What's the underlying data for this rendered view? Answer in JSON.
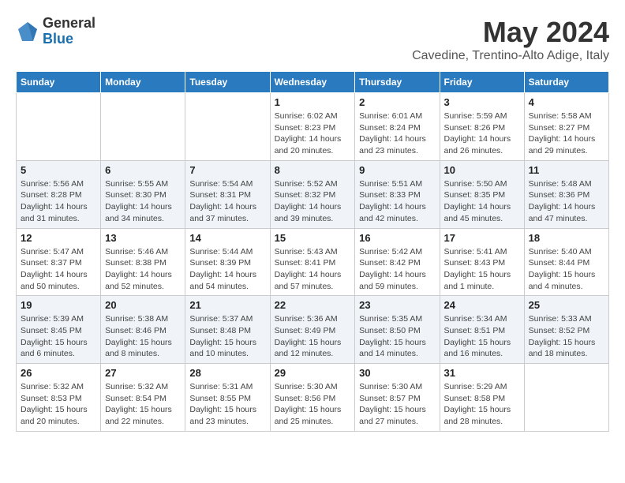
{
  "header": {
    "logo_general": "General",
    "logo_blue": "Blue",
    "month": "May 2024",
    "location": "Cavedine, Trentino-Alto Adige, Italy"
  },
  "days_of_week": [
    "Sunday",
    "Monday",
    "Tuesday",
    "Wednesday",
    "Thursday",
    "Friday",
    "Saturday"
  ],
  "weeks": [
    [
      {
        "day": "",
        "sunrise": "",
        "sunset": "",
        "daylight": ""
      },
      {
        "day": "",
        "sunrise": "",
        "sunset": "",
        "daylight": ""
      },
      {
        "day": "",
        "sunrise": "",
        "sunset": "",
        "daylight": ""
      },
      {
        "day": "1",
        "sunrise": "Sunrise: 6:02 AM",
        "sunset": "Sunset: 8:23 PM",
        "daylight": "Daylight: 14 hours and 20 minutes."
      },
      {
        "day": "2",
        "sunrise": "Sunrise: 6:01 AM",
        "sunset": "Sunset: 8:24 PM",
        "daylight": "Daylight: 14 hours and 23 minutes."
      },
      {
        "day": "3",
        "sunrise": "Sunrise: 5:59 AM",
        "sunset": "Sunset: 8:26 PM",
        "daylight": "Daylight: 14 hours and 26 minutes."
      },
      {
        "day": "4",
        "sunrise": "Sunrise: 5:58 AM",
        "sunset": "Sunset: 8:27 PM",
        "daylight": "Daylight: 14 hours and 29 minutes."
      }
    ],
    [
      {
        "day": "5",
        "sunrise": "Sunrise: 5:56 AM",
        "sunset": "Sunset: 8:28 PM",
        "daylight": "Daylight: 14 hours and 31 minutes."
      },
      {
        "day": "6",
        "sunrise": "Sunrise: 5:55 AM",
        "sunset": "Sunset: 8:30 PM",
        "daylight": "Daylight: 14 hours and 34 minutes."
      },
      {
        "day": "7",
        "sunrise": "Sunrise: 5:54 AM",
        "sunset": "Sunset: 8:31 PM",
        "daylight": "Daylight: 14 hours and 37 minutes."
      },
      {
        "day": "8",
        "sunrise": "Sunrise: 5:52 AM",
        "sunset": "Sunset: 8:32 PM",
        "daylight": "Daylight: 14 hours and 39 minutes."
      },
      {
        "day": "9",
        "sunrise": "Sunrise: 5:51 AM",
        "sunset": "Sunset: 8:33 PM",
        "daylight": "Daylight: 14 hours and 42 minutes."
      },
      {
        "day": "10",
        "sunrise": "Sunrise: 5:50 AM",
        "sunset": "Sunset: 8:35 PM",
        "daylight": "Daylight: 14 hours and 45 minutes."
      },
      {
        "day": "11",
        "sunrise": "Sunrise: 5:48 AM",
        "sunset": "Sunset: 8:36 PM",
        "daylight": "Daylight: 14 hours and 47 minutes."
      }
    ],
    [
      {
        "day": "12",
        "sunrise": "Sunrise: 5:47 AM",
        "sunset": "Sunset: 8:37 PM",
        "daylight": "Daylight: 14 hours and 50 minutes."
      },
      {
        "day": "13",
        "sunrise": "Sunrise: 5:46 AM",
        "sunset": "Sunset: 8:38 PM",
        "daylight": "Daylight: 14 hours and 52 minutes."
      },
      {
        "day": "14",
        "sunrise": "Sunrise: 5:44 AM",
        "sunset": "Sunset: 8:39 PM",
        "daylight": "Daylight: 14 hours and 54 minutes."
      },
      {
        "day": "15",
        "sunrise": "Sunrise: 5:43 AM",
        "sunset": "Sunset: 8:41 PM",
        "daylight": "Daylight: 14 hours and 57 minutes."
      },
      {
        "day": "16",
        "sunrise": "Sunrise: 5:42 AM",
        "sunset": "Sunset: 8:42 PM",
        "daylight": "Daylight: 14 hours and 59 minutes."
      },
      {
        "day": "17",
        "sunrise": "Sunrise: 5:41 AM",
        "sunset": "Sunset: 8:43 PM",
        "daylight": "Daylight: 15 hours and 1 minute."
      },
      {
        "day": "18",
        "sunrise": "Sunrise: 5:40 AM",
        "sunset": "Sunset: 8:44 PM",
        "daylight": "Daylight: 15 hours and 4 minutes."
      }
    ],
    [
      {
        "day": "19",
        "sunrise": "Sunrise: 5:39 AM",
        "sunset": "Sunset: 8:45 PM",
        "daylight": "Daylight: 15 hours and 6 minutes."
      },
      {
        "day": "20",
        "sunrise": "Sunrise: 5:38 AM",
        "sunset": "Sunset: 8:46 PM",
        "daylight": "Daylight: 15 hours and 8 minutes."
      },
      {
        "day": "21",
        "sunrise": "Sunrise: 5:37 AM",
        "sunset": "Sunset: 8:48 PM",
        "daylight": "Daylight: 15 hours and 10 minutes."
      },
      {
        "day": "22",
        "sunrise": "Sunrise: 5:36 AM",
        "sunset": "Sunset: 8:49 PM",
        "daylight": "Daylight: 15 hours and 12 minutes."
      },
      {
        "day": "23",
        "sunrise": "Sunrise: 5:35 AM",
        "sunset": "Sunset: 8:50 PM",
        "daylight": "Daylight: 15 hours and 14 minutes."
      },
      {
        "day": "24",
        "sunrise": "Sunrise: 5:34 AM",
        "sunset": "Sunset: 8:51 PM",
        "daylight": "Daylight: 15 hours and 16 minutes."
      },
      {
        "day": "25",
        "sunrise": "Sunrise: 5:33 AM",
        "sunset": "Sunset: 8:52 PM",
        "daylight": "Daylight: 15 hours and 18 minutes."
      }
    ],
    [
      {
        "day": "26",
        "sunrise": "Sunrise: 5:32 AM",
        "sunset": "Sunset: 8:53 PM",
        "daylight": "Daylight: 15 hours and 20 minutes."
      },
      {
        "day": "27",
        "sunrise": "Sunrise: 5:32 AM",
        "sunset": "Sunset: 8:54 PM",
        "daylight": "Daylight: 15 hours and 22 minutes."
      },
      {
        "day": "28",
        "sunrise": "Sunrise: 5:31 AM",
        "sunset": "Sunset: 8:55 PM",
        "daylight": "Daylight: 15 hours and 23 minutes."
      },
      {
        "day": "29",
        "sunrise": "Sunrise: 5:30 AM",
        "sunset": "Sunset: 8:56 PM",
        "daylight": "Daylight: 15 hours and 25 minutes."
      },
      {
        "day": "30",
        "sunrise": "Sunrise: 5:30 AM",
        "sunset": "Sunset: 8:57 PM",
        "daylight": "Daylight: 15 hours and 27 minutes."
      },
      {
        "day": "31",
        "sunrise": "Sunrise: 5:29 AM",
        "sunset": "Sunset: 8:58 PM",
        "daylight": "Daylight: 15 hours and 28 minutes."
      },
      {
        "day": "",
        "sunrise": "",
        "sunset": "",
        "daylight": ""
      }
    ]
  ]
}
